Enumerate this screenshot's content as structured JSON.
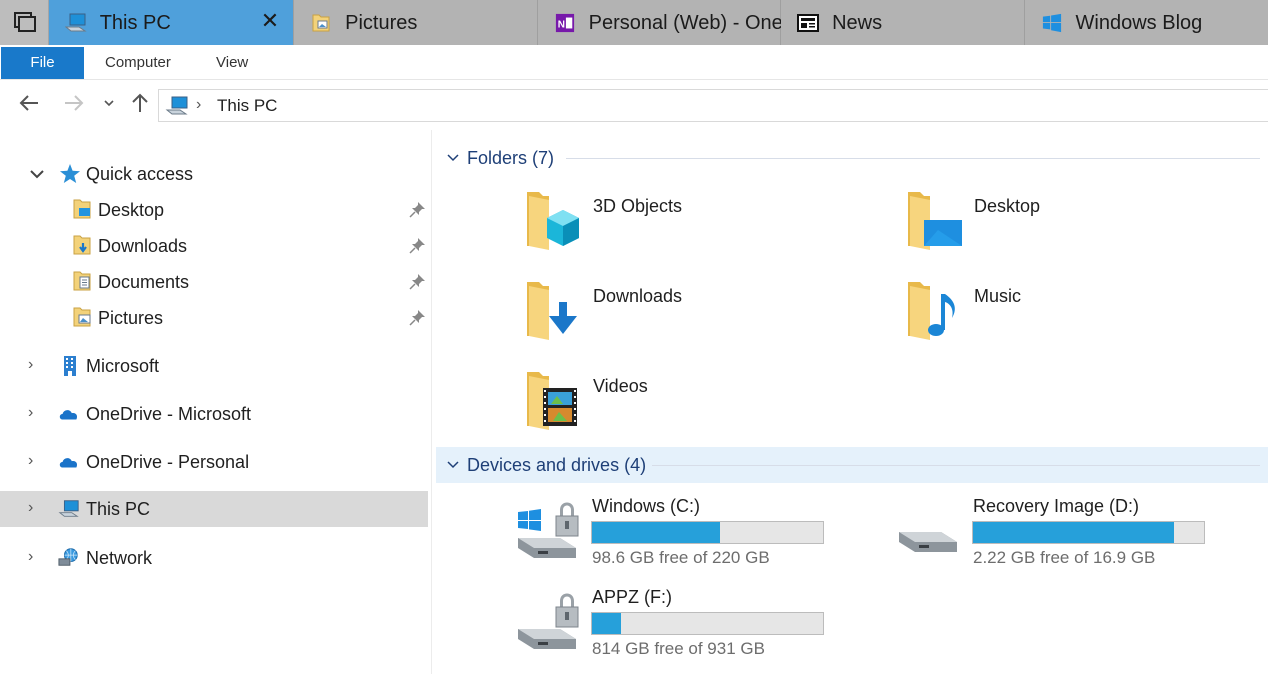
{
  "tabs": [
    {
      "label": "This PC",
      "icon": "computer-icon",
      "active": true
    },
    {
      "label": "Pictures",
      "icon": "pictures-folder-icon"
    },
    {
      "label": "Personal (Web) - One",
      "icon": "onenote-icon"
    },
    {
      "label": "News",
      "icon": "news-icon"
    },
    {
      "label": "Windows Blog",
      "icon": "windows-logo-icon"
    }
  ],
  "tab_close": "✕",
  "ribbon": {
    "file": "File",
    "computer": "Computer",
    "view": "View"
  },
  "address": {
    "location": "This PC",
    "icon": "computer-icon"
  },
  "nav": {
    "quick_access": "Quick access",
    "quick_items": [
      {
        "label": "Desktop",
        "icon": "desktop-folder-icon"
      },
      {
        "label": "Downloads",
        "icon": "downloads-folder-icon"
      },
      {
        "label": "Documents",
        "icon": "documents-folder-icon"
      },
      {
        "label": "Pictures",
        "icon": "pictures-folder-icon"
      }
    ],
    "roots": [
      {
        "label": "Microsoft",
        "icon": "building-icon"
      },
      {
        "label": "OneDrive - Microsoft",
        "icon": "onedrive-icon"
      },
      {
        "label": "OneDrive - Personal",
        "icon": "onedrive-icon"
      },
      {
        "label": "This PC",
        "icon": "computer-icon",
        "selected": true
      },
      {
        "label": "Network",
        "icon": "network-icon"
      }
    ]
  },
  "folders": {
    "title": "Folders (7)",
    "items": [
      {
        "label": "3D Objects",
        "icon": "3d-objects-folder-icon"
      },
      {
        "label": "Desktop",
        "icon": "desktop-folder-icon"
      },
      {
        "label": "Downloads",
        "icon": "downloads-folder-icon"
      },
      {
        "label": "Music",
        "icon": "music-folder-icon"
      },
      {
        "label": "Videos",
        "icon": "videos-folder-icon"
      }
    ]
  },
  "drives": {
    "title": "Devices and drives (4)",
    "items": [
      {
        "label": "Windows (C:)",
        "free": "98.6 GB free of 220 GB",
        "used_fraction": 0.552,
        "icon": "windows-drive-icon"
      },
      {
        "label": "Recovery Image (D:)",
        "free": "2.22 GB free of 16.9 GB",
        "used_fraction": 0.869,
        "icon": "drive-icon"
      },
      {
        "label": "APPZ (F:)",
        "free": "814 GB free of 931 GB",
        "used_fraction": 0.126,
        "icon": "locked-drive-icon"
      }
    ]
  },
  "colors": {
    "accent": "#1979ca",
    "tab_active": "#4fa0db",
    "bar_fill": "#26a0da",
    "group_title": "#1e3f77"
  }
}
